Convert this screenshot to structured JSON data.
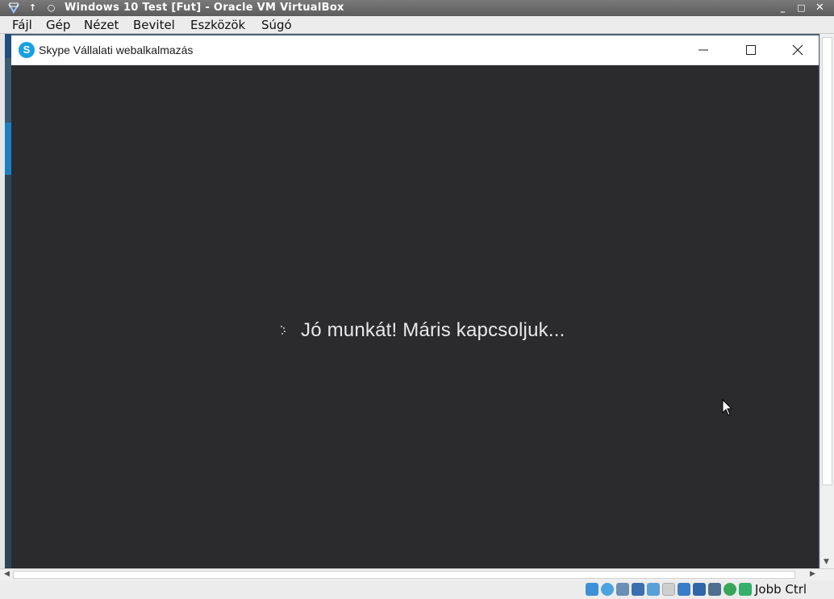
{
  "host": {
    "title": "Windows 10 Test [Fut] - Oracle VM VirtualBox",
    "menu": [
      "Fájl",
      "Gép",
      "Nézet",
      "Bevitel",
      "Eszközök",
      "Súgó"
    ],
    "host_key": "Jobb Ctrl"
  },
  "app": {
    "title": "Skype Vállalati webalkalmazás",
    "icon_letter": "S",
    "loading_text": "Jó munkát! Máris kapcsoljuk..."
  },
  "status_icons": [
    "hard-disk-icon",
    "optical-drive-icon",
    "audio-icon",
    "network-icon",
    "usb-icon",
    "shared-folders-icon",
    "display-icon",
    "recording-icon",
    "cpu-icon",
    "mouse-integration-icon",
    "keyboard-icon"
  ]
}
